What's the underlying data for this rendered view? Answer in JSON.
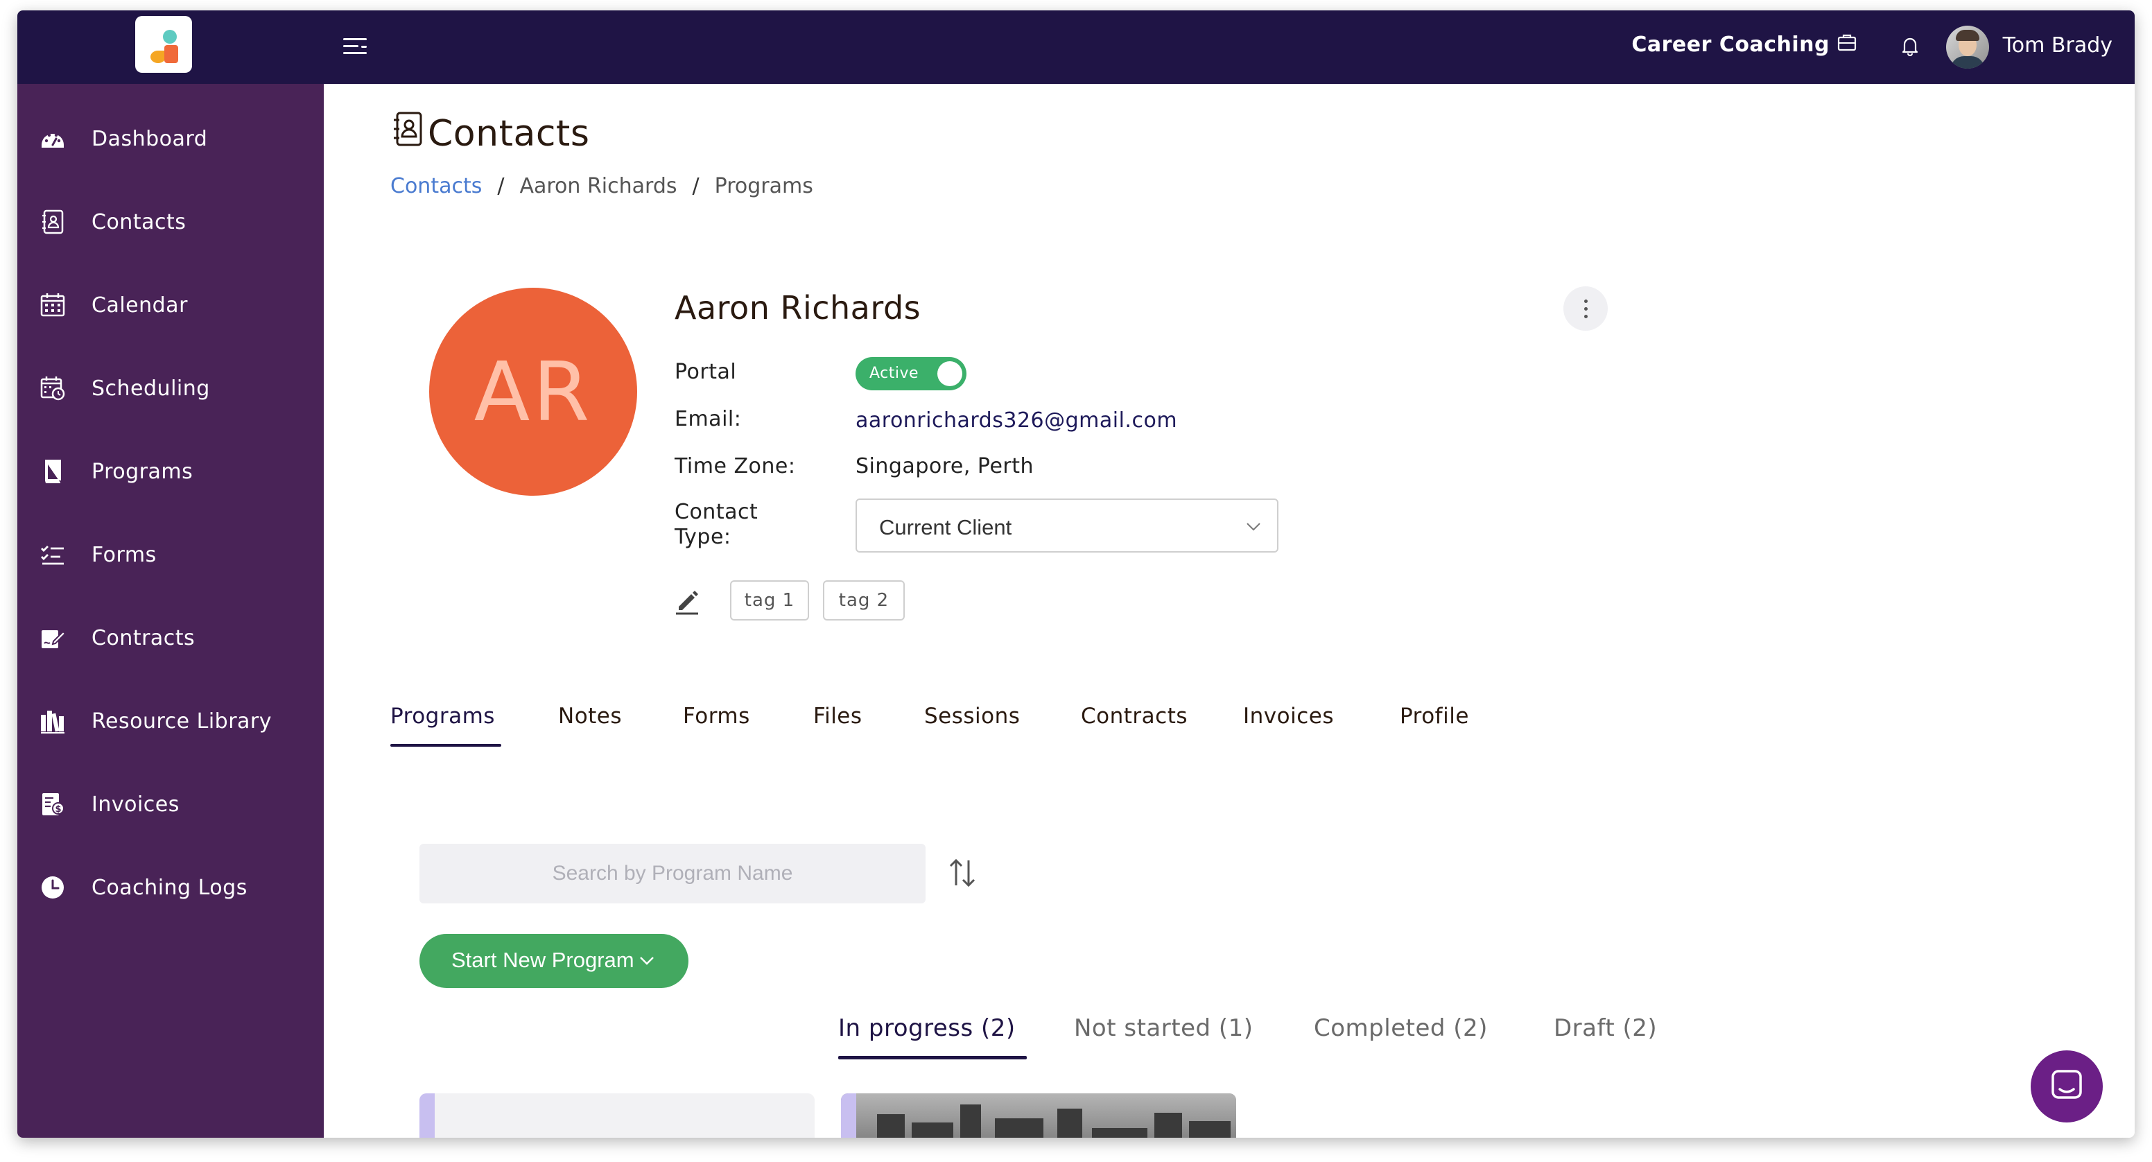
{
  "header": {
    "org_name": "Career Coaching",
    "user_name": "Tom Brady"
  },
  "sidebar": {
    "items": [
      {
        "label": "Dashboard",
        "icon": "dashboard-icon"
      },
      {
        "label": "Contacts",
        "icon": "contacts-icon"
      },
      {
        "label": "Calendar",
        "icon": "calendar-icon"
      },
      {
        "label": "Scheduling",
        "icon": "scheduling-icon"
      },
      {
        "label": "Programs",
        "icon": "programs-icon"
      },
      {
        "label": "Forms",
        "icon": "forms-icon"
      },
      {
        "label": "Contracts",
        "icon": "contracts-icon"
      },
      {
        "label": "Resource Library",
        "icon": "resource-library-icon"
      },
      {
        "label": "Invoices",
        "icon": "invoices-icon"
      },
      {
        "label": "Coaching Logs",
        "icon": "clock-icon"
      }
    ]
  },
  "page": {
    "title": "Contacts",
    "breadcrumb": [
      "Contacts",
      "Aaron Richards",
      "Programs"
    ]
  },
  "contact": {
    "initials": "AR",
    "name": "Aaron Richards",
    "portal_label": "Portal",
    "portal_status": "Active",
    "email_label": "Email:",
    "email": "aaronrichards326@gmail.com",
    "timezone_label": "Time Zone:",
    "timezone": "Singapore, Perth",
    "contact_type_label_1": "Contact",
    "contact_type_label_2": "Type:",
    "contact_type": "Current Client",
    "tags": [
      "tag 1",
      "tag 2"
    ]
  },
  "tabs": [
    {
      "label": "Programs",
      "active": true
    },
    {
      "label": "Notes"
    },
    {
      "label": "Forms"
    },
    {
      "label": "Files"
    },
    {
      "label": "Sessions"
    },
    {
      "label": "Contracts"
    },
    {
      "label": "Invoices"
    },
    {
      "label": "Profile"
    }
  ],
  "programs": {
    "search_placeholder": "Search by Program Name",
    "start_button": "Start New Program",
    "status_tabs": [
      {
        "label": "In progress (2)",
        "active": true
      },
      {
        "label": "Not started (1)"
      },
      {
        "label": "Completed (2)"
      },
      {
        "label": "Draft (2)"
      }
    ]
  },
  "colors": {
    "topbar": "#1f1445",
    "sidebar": "#492357",
    "avatar": "#ec6239",
    "active_toggle": "#3bb06a",
    "start_button": "#43a860",
    "link": "#4a7bd0",
    "chat_button": "#6b1f86"
  }
}
